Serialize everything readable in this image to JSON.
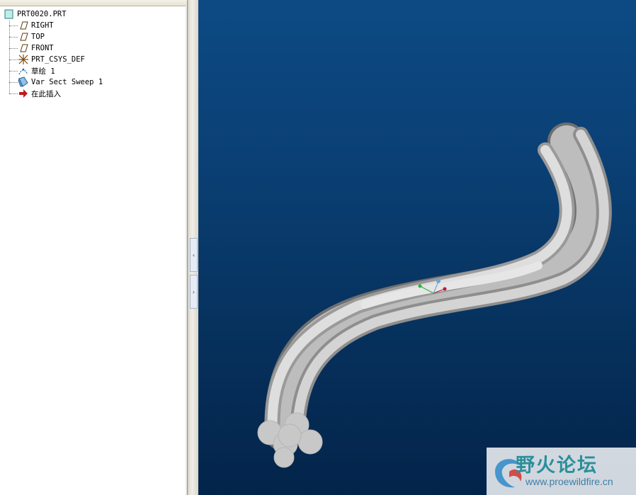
{
  "model_tree": {
    "root": "PRT0020.PRT",
    "items": [
      {
        "label": "RIGHT",
        "icon": "datum-plane-icon"
      },
      {
        "label": "TOP",
        "icon": "datum-plane-icon"
      },
      {
        "label": "FRONT",
        "icon": "datum-plane-icon"
      },
      {
        "label": "PRT_CSYS_DEF",
        "icon": "coordinate-system-icon"
      },
      {
        "label": "草绘 1",
        "icon": "sketch-icon"
      },
      {
        "label": "Var Sect Sweep 1",
        "icon": "sweep-feature-icon"
      },
      {
        "label": "在此插入",
        "icon": "insert-here-arrow-icon"
      }
    ]
  },
  "splitter": {
    "collapse_glyph": "‹",
    "expand_glyph": "›"
  },
  "watermark": {
    "title": "野火论坛",
    "url": "www.proewildfire.cn"
  },
  "colors": {
    "viewport_top": "#0d4a84",
    "viewport_bottom": "#03244a",
    "model": "#c8c8c8"
  }
}
